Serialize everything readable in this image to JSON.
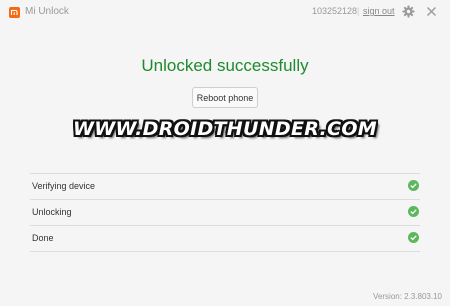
{
  "window": {
    "title": "Mi Unlock",
    "account_id": "103252128",
    "separator": "|",
    "signout_label": "sign out",
    "settings_icon": "gear-icon",
    "close_icon": "close-icon"
  },
  "main": {
    "headline": "Unlocked successfully",
    "reboot_label": "Reboot phone",
    "watermark": "WWW.DROIDTHUNDER.COM"
  },
  "steps": [
    {
      "label": "Verifying device",
      "status": "done"
    },
    {
      "label": "Unlocking",
      "status": "done"
    },
    {
      "label": "Done",
      "status": "done"
    }
  ],
  "footer": {
    "version": "Version: 2.3.803.10"
  },
  "colors": {
    "brand": "#f56a12",
    "success": "#1f8a2f",
    "check": "#5cb85c",
    "background": "#f5f5f5"
  }
}
